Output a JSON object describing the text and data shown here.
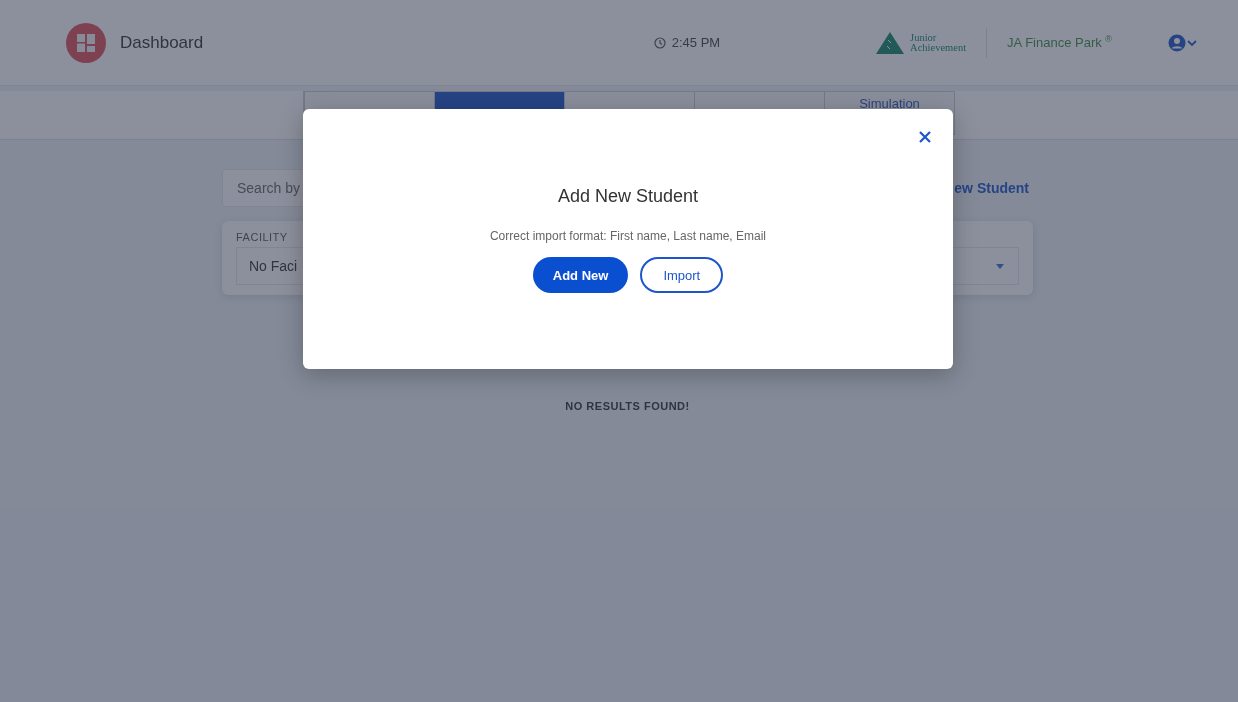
{
  "header": {
    "title": "Dashboard",
    "time": "2:45 PM",
    "brand": [
      "Junior",
      "Achievement"
    ],
    "program": "JA Finance Park",
    "program_mark": "®"
  },
  "tabs": [
    {
      "selected": false
    },
    {
      "selected": true
    },
    {
      "selected": false
    },
    {
      "selected": false
    },
    {
      "label": "Simulation",
      "selected": false
    }
  ],
  "search": {
    "placeholder": "Search by"
  },
  "add_link": "ew Student",
  "filters": {
    "label": "FACILITY",
    "value": "No Faci"
  },
  "empty_message": "NO RESULTS FOUND!",
  "modal": {
    "title": "Add New Student",
    "text": "Correct import format: First name, Last name, Email",
    "buttons": [
      {
        "label": "Add New",
        "kind": "primary"
      },
      {
        "label": "Import",
        "kind": "outline"
      }
    ]
  }
}
